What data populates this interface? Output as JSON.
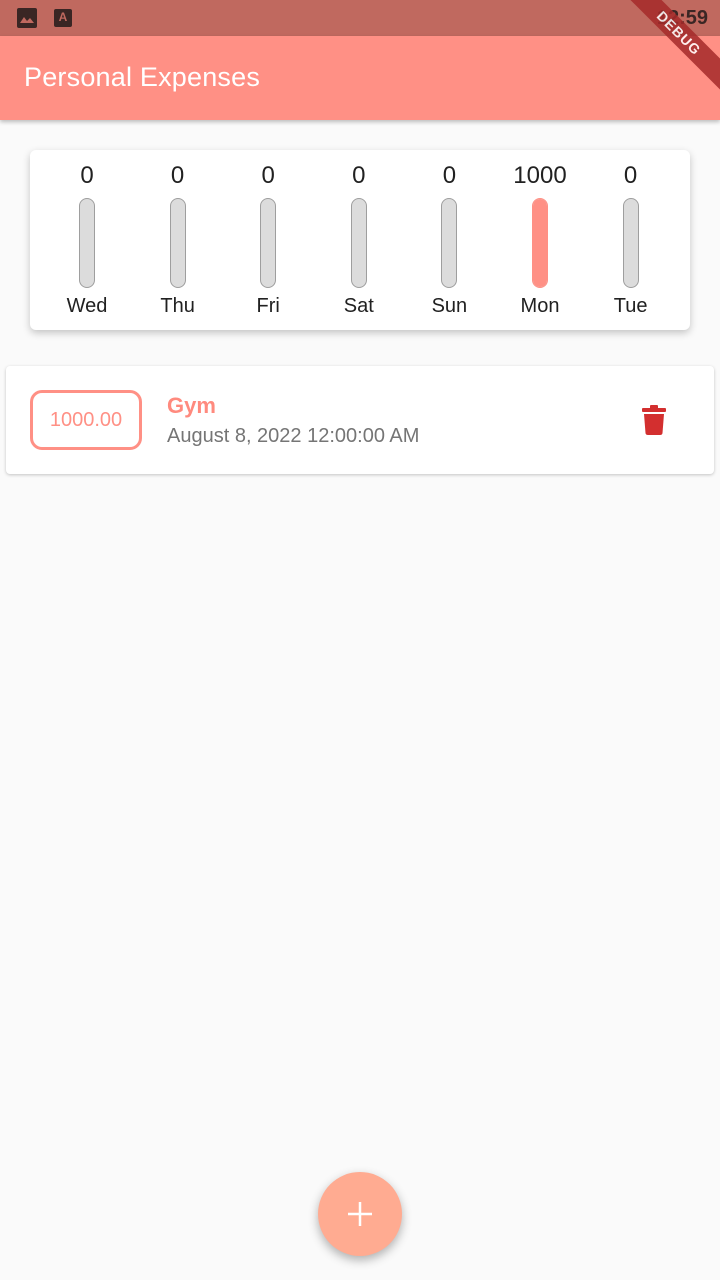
{
  "status_bar": {
    "time": "12:59",
    "icons": [
      "gallery-icon",
      "font-icon"
    ]
  },
  "app_bar": {
    "title": "Personal Expenses",
    "debug_label": "DEBUG"
  },
  "chart_data": {
    "type": "bar",
    "categories": [
      "Wed",
      "Thu",
      "Fri",
      "Sat",
      "Sun",
      "Mon",
      "Tue"
    ],
    "values": [
      0,
      0,
      0,
      0,
      0,
      1000,
      0
    ],
    "value_labels": [
      "0",
      "0",
      "0",
      "0",
      "0",
      "1000",
      "0"
    ],
    "fill_fraction": [
      0,
      0,
      0,
      0,
      0,
      1,
      0
    ]
  },
  "transactions": [
    {
      "amount": "1000.00",
      "title": "Gym",
      "date": "August 8, 2022 12:00:00 AM",
      "action_icon": "delete-icon"
    }
  ],
  "fab": {
    "icon": "add-icon"
  },
  "colors": {
    "primary": "#ff9085",
    "status_bar": "#c0695f",
    "accent": "#ffab91",
    "delete": "#d32f2f",
    "track": "#dcdcdc"
  }
}
